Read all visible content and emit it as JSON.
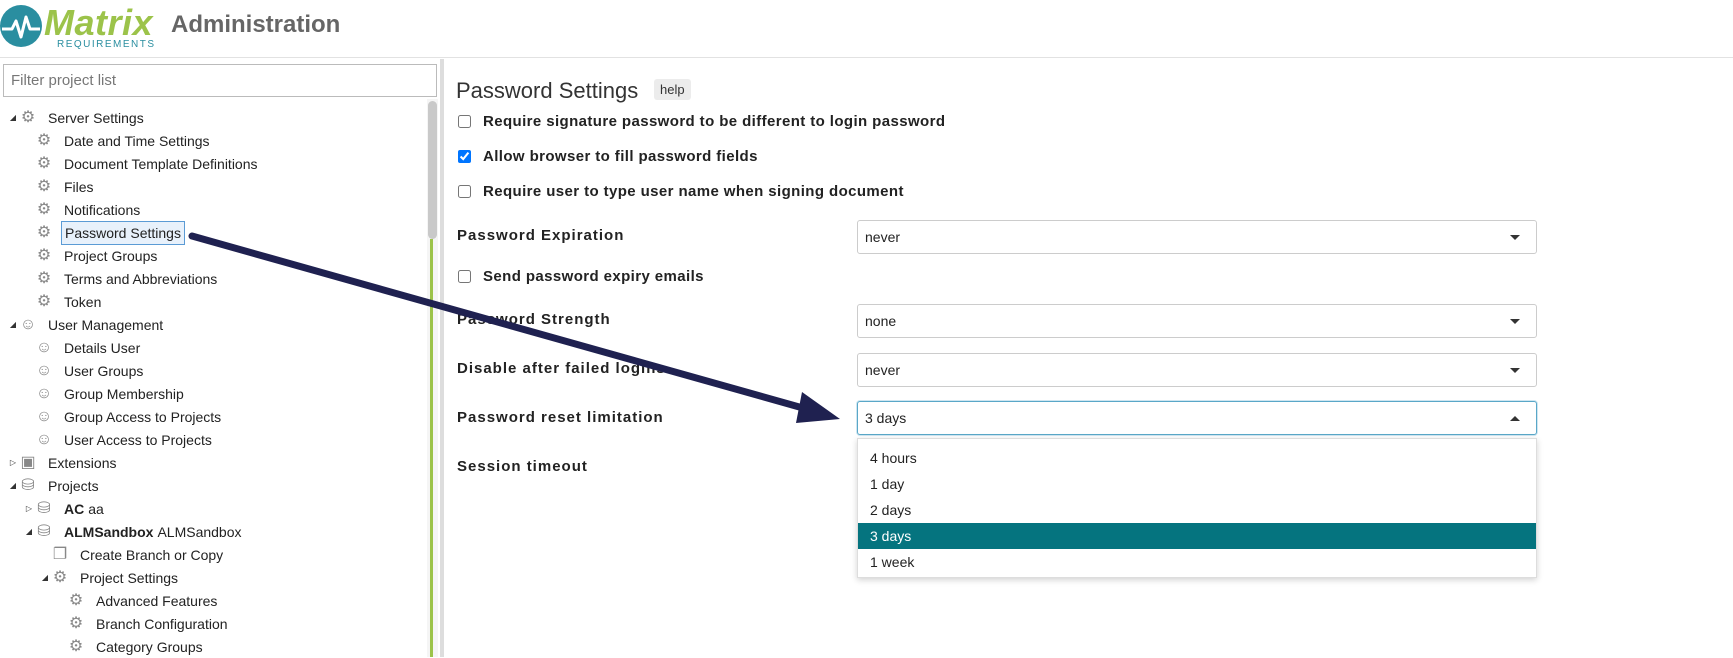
{
  "header": {
    "logo_word": "Matrix",
    "logo_sub": "REQUIREMENTS",
    "title": "Administration"
  },
  "sidebar": {
    "filter_placeholder": "Filter project list",
    "tree": [
      {
        "label": "Server Settings",
        "level": 0,
        "toggle": "open",
        "icon": "gears-icon"
      },
      {
        "label": "Date and Time Settings",
        "level": 1,
        "icon": "gear-icon"
      },
      {
        "label": "Document Template Definitions",
        "level": 1,
        "icon": "gear-icon"
      },
      {
        "label": "Files",
        "level": 1,
        "icon": "gear-icon"
      },
      {
        "label": "Notifications",
        "level": 1,
        "icon": "gear-icon"
      },
      {
        "label": "Password Settings",
        "level": 1,
        "icon": "gear-icon",
        "selected": true
      },
      {
        "label": "Project Groups",
        "level": 1,
        "icon": "gear-icon"
      },
      {
        "label": "Terms and Abbreviations",
        "level": 1,
        "icon": "gear-icon"
      },
      {
        "label": "Token",
        "level": 1,
        "icon": "gear-icon"
      },
      {
        "label": "User Management",
        "level": 0,
        "toggle": "open",
        "icon": "users-icon"
      },
      {
        "label": "Details User",
        "level": 1,
        "icon": "user-gear-icon"
      },
      {
        "label": "User Groups",
        "level": 1,
        "icon": "user-gear-icon"
      },
      {
        "label": "Group Membership",
        "level": 1,
        "icon": "user-gear-icon"
      },
      {
        "label": "Group Access to Projects",
        "level": 1,
        "icon": "user-gear-icon"
      },
      {
        "label": "User Access to Projects",
        "level": 1,
        "icon": "user-gear-icon"
      },
      {
        "label": "Extensions",
        "level": 0,
        "toggle": "closed",
        "icon": "extension-icon"
      },
      {
        "label": "Projects",
        "level": 0,
        "toggle": "open",
        "icon": "database-gear-icon"
      },
      {
        "label": "AC",
        "extra": "aa",
        "level": 1,
        "toggle": "closed",
        "icon": "database-icon"
      },
      {
        "label": "ALMSandbox",
        "extra": "ALMSandbox",
        "level": 1,
        "toggle": "open",
        "icon": "database-icon"
      },
      {
        "label": "Create Branch or Copy",
        "level": 2,
        "icon": "copy-icon"
      },
      {
        "label": "Project Settings",
        "level": 2,
        "toggle": "open",
        "icon": "gears-icon"
      },
      {
        "label": "Advanced Features",
        "level": 3,
        "icon": "gear-icon"
      },
      {
        "label": "Branch Configuration",
        "level": 3,
        "icon": "gear-icon"
      },
      {
        "label": "Category Groups",
        "level": 3,
        "icon": "gear-icon"
      }
    ]
  },
  "main": {
    "title": "Password Settings",
    "help_label": "help",
    "checkboxes": {
      "sig_pw_diff": {
        "label": "Require signature password to be different to login password",
        "checked": false
      },
      "browser_fill": {
        "label": "Allow browser to fill password fields",
        "checked": true
      },
      "type_username": {
        "label": "Require user to type user name when signing document",
        "checked": false
      },
      "expiry_emails": {
        "label": "Send password expiry emails",
        "checked": false
      }
    },
    "fields": {
      "expiration": {
        "label": "Password Expiration",
        "value": "never"
      },
      "strength": {
        "label": "Password Strength",
        "value": "none"
      },
      "disable_failed": {
        "label": "Disable after failed logins",
        "value": "never"
      },
      "reset_limit": {
        "label": "Password reset limitation",
        "value": "3 days"
      },
      "session_timeout": {
        "label": "Session timeout"
      }
    },
    "dropdown_options": [
      "4 hours",
      "1 day",
      "2 days",
      "3 days",
      "1 week"
    ],
    "dropdown_selected": "3 days"
  },
  "colors": {
    "brand_green": "#9cc34a",
    "brand_teal": "#2a8ea0",
    "selected_option": "#05747f",
    "arrow": "#1f2150"
  }
}
